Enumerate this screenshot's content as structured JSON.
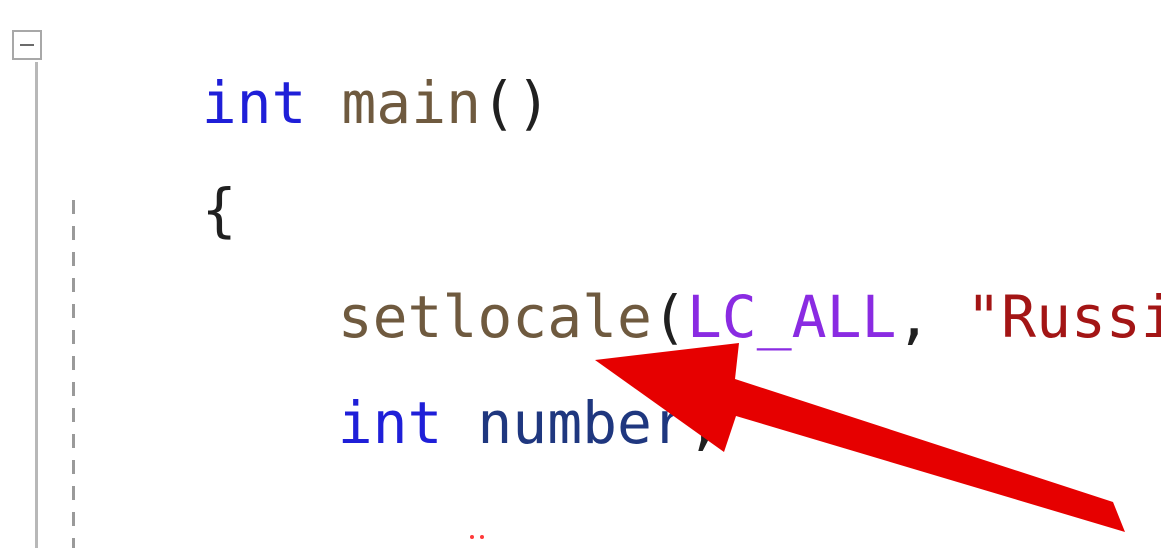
{
  "code": {
    "line1": {
      "kw": "int",
      "space": " ",
      "fn": "main",
      "paren": "()"
    },
    "line2": {
      "brace": "{"
    },
    "line3": {
      "fn": "setlocale",
      "open": "(",
      "macro": "LC_ALL",
      "comma": ", ",
      "str": "\"Russian\"",
      "close": ");"
    },
    "line4": {
      "kw": "int",
      "space": " ",
      "ident": "number",
      "semi": ";"
    }
  },
  "colors": {
    "keyword": "#1f1fd8",
    "function": "#6f5a3f",
    "macro": "#8a2be2",
    "string": "#a31515",
    "identifier": "#1f377f",
    "annotation_arrow": "#e60000",
    "fold_line": "#b8b8b8"
  },
  "icons": {
    "fold": "minus-fold-icon",
    "annotation": "red-arrow-icon"
  }
}
